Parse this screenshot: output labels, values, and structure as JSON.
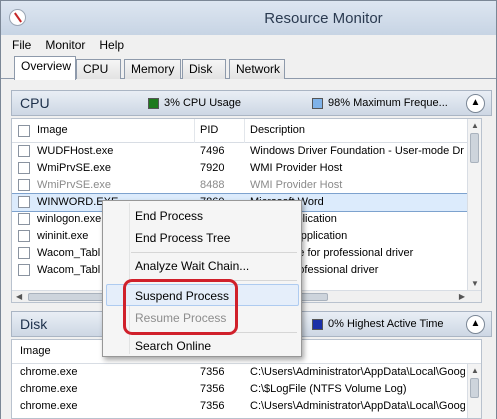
{
  "window": {
    "title": "Resource Monitor"
  },
  "menu": [
    "File",
    "Monitor",
    "Help"
  ],
  "tabs": [
    "Overview",
    "CPU",
    "Memory",
    "Disk",
    "Network"
  ],
  "cpu": {
    "title": "CPU",
    "usage_text": "3% CPU Usage",
    "usage_color": "#1e7a1e",
    "freq_text": "98% Maximum Freque...",
    "freq_color": "#7fb2e8",
    "columns": [
      "Image",
      "PID",
      "Description"
    ],
    "rows": [
      {
        "image": "WUDFHost.exe",
        "pid": "7496",
        "description": "Windows Driver Foundation - User-mode Dr"
      },
      {
        "image": "WmiPrvSE.exe",
        "pid": "7920",
        "description": "WMI Provider Host"
      },
      {
        "image": "WmiPrvSE.exe",
        "pid": "8488",
        "description": "WMI Provider Host"
      },
      {
        "image": "WINWORD.EXE",
        "pid": "7860",
        "description": "Microsoft Word"
      },
      {
        "image": "winlogon.exe",
        "pid": "",
        "description": "Logon Application"
      },
      {
        "image": "wininit.exe",
        "pid": "",
        "description": "Start-Up Application"
      },
      {
        "image": "Wacom_Tabl",
        "pid": "",
        "description": "ver module for professional driver"
      },
      {
        "image": "Wacom_Tabl",
        "pid": "",
        "description": "vice for professional driver"
      }
    ]
  },
  "disk": {
    "title": "Disk",
    "active_text": "0% Highest Active Time",
    "active_color": "#1a2fa8",
    "columns": [
      "Image"
    ],
    "rows": [
      {
        "image": "chrome.exe",
        "pid": "7356",
        "file": "C:\\Users\\Administrator\\AppData\\Local\\Goog"
      },
      {
        "image": "chrome.exe",
        "pid": "7356",
        "file": "C:\\$LogFile (NTFS Volume Log)"
      },
      {
        "image": "chrome.exe",
        "pid": "7356",
        "file": "C:\\Users\\Administrator\\AppData\\Local\\Goog"
      }
    ]
  },
  "context_menu": {
    "items": [
      "End Process",
      "End Process Tree",
      "Analyze Wait Chain...",
      "Suspend Process",
      "Resume Process",
      "Search Online"
    ]
  }
}
